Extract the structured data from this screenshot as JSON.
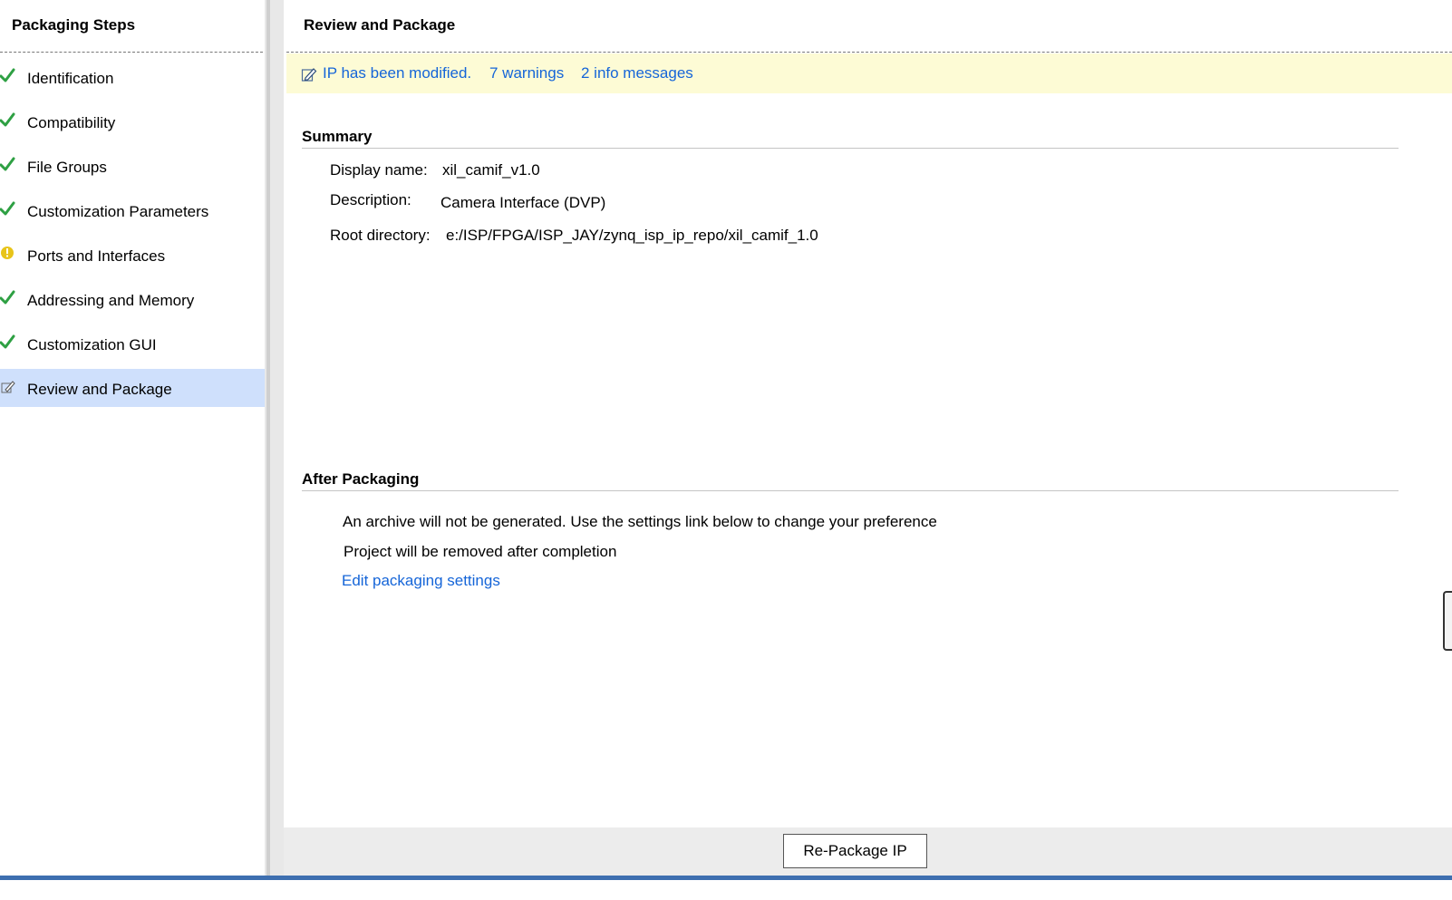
{
  "left_panel": {
    "title": "Packaging Steps",
    "steps": [
      {
        "label": "Identification",
        "status": "complete",
        "icon": "check-icon"
      },
      {
        "label": "Compatibility",
        "status": "complete",
        "icon": "check-icon"
      },
      {
        "label": "File Groups",
        "status": "complete",
        "icon": "check-icon"
      },
      {
        "label": "Customization Parameters",
        "status": "complete",
        "icon": "check-icon"
      },
      {
        "label": "Ports and Interfaces",
        "status": "warning",
        "icon": "warning-icon"
      },
      {
        "label": "Addressing and Memory",
        "status": "complete",
        "icon": "check-icon"
      },
      {
        "label": "Customization GUI",
        "status": "complete",
        "icon": "check-icon"
      },
      {
        "label": "Review and Package",
        "status": "active",
        "icon": "edit-icon"
      }
    ]
  },
  "main": {
    "title": "Review and Package",
    "banner": {
      "icon": "edit-icon",
      "modified_link": "IP has been modified.",
      "warnings_link": "7 warnings",
      "info_link": "2 info messages"
    },
    "summary": {
      "heading": "Summary",
      "display_name_label": "Display name:",
      "display_name_value": "xil_camif_v1.0",
      "description_label": "Description:",
      "description_value": "Camera Interface (DVP)",
      "root_dir_label": "Root directory:",
      "root_dir_value": "e:/ISP/FPGA/ISP_JAY/zynq_isp_ip_repo/xil_camif_1.0"
    },
    "after_packaging": {
      "heading": "After Packaging",
      "archive_text": "An archive will not be generated. Use the settings link below to change your preference",
      "project_text": "Project will be removed after completion",
      "settings_link": "Edit packaging settings"
    }
  },
  "footer": {
    "repackage_button": "Re-Package IP"
  },
  "colors": {
    "check_green": "#2ea043",
    "warning_yellow": "#e8c41a",
    "link_blue": "#1565d8",
    "banner_yellow": "#fdfbd5",
    "active_row": "#cfe0fc",
    "bottom_line": "#3e6fb0"
  }
}
